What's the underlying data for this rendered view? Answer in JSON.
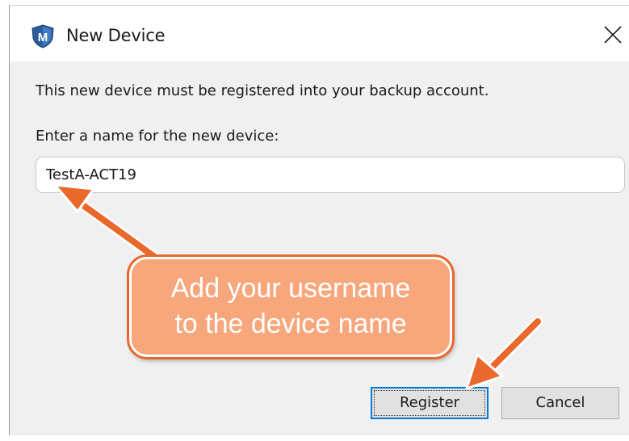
{
  "window": {
    "title": "New Device",
    "icon_name": "shield-m-icon",
    "close_icon": "close-icon"
  },
  "dialog": {
    "message": "This new device must be registered into your backup account.",
    "field_label": "Enter a name for the new device:",
    "device_name_value": "TestA-ACT19"
  },
  "buttons": {
    "register_label": "Register",
    "cancel_label": "Cancel"
  },
  "annotation": {
    "callout_text": "Add your username\nto the device name",
    "callout_color": "#f7a77b",
    "arrow_color": "#e9692c"
  }
}
